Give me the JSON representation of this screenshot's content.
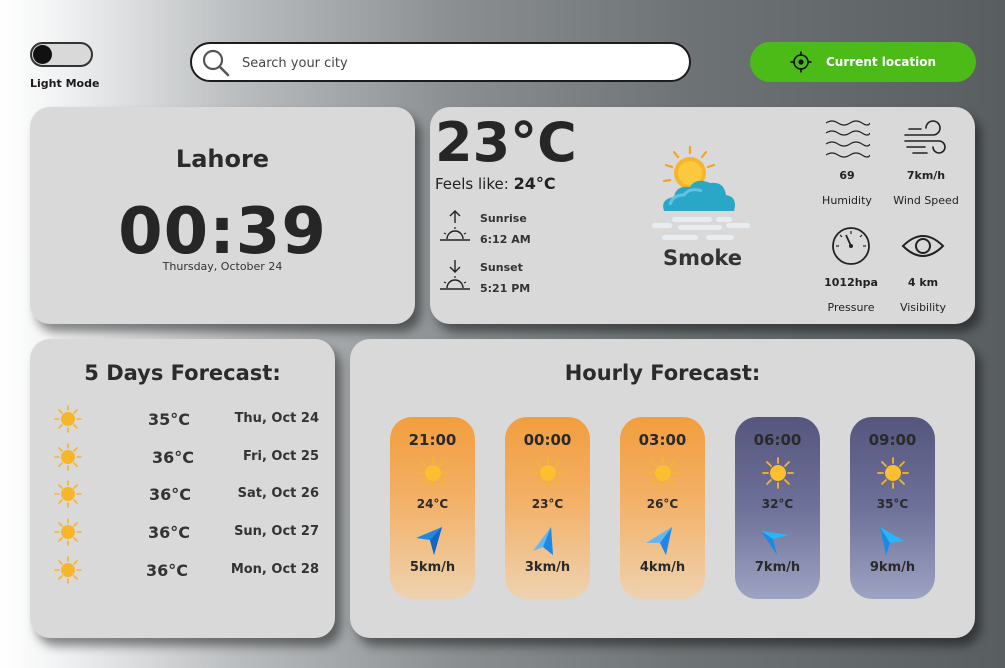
{
  "header": {
    "mode_label": "Light Mode",
    "search_placeholder": "Search your city",
    "location_button": "Current location"
  },
  "city": {
    "name": "Lahore",
    "time": "00:39",
    "date": "Thursday, October 24"
  },
  "current": {
    "temperature": "23°C",
    "feels_like_label": "Feels like:",
    "feels_like_value": "24°C",
    "sunrise_label": "Sunrise",
    "sunrise_time": "6:12 AM",
    "sunset_label": "Sunset",
    "sunset_time": "5:21 PM",
    "condition": "Smoke",
    "stats": [
      {
        "icon": "humidity-waves-icon",
        "value": "69",
        "label": "Humidity"
      },
      {
        "icon": "wind-icon",
        "value": "7km/h",
        "label": "Wind Speed"
      },
      {
        "icon": "pressure-gauge-icon",
        "value": "1012hpa",
        "label": "Pressure"
      },
      {
        "icon": "eye-icon",
        "value": "4 km",
        "label": "Visibility"
      }
    ]
  },
  "five_day": {
    "title": "5 Days Forecast:",
    "days": [
      {
        "temp": "35°C",
        "date": "Thu, Oct 24"
      },
      {
        "temp": "36°C",
        "date": "Fri, Oct 25"
      },
      {
        "temp": "36°C",
        "date": "Sat, Oct 26"
      },
      {
        "temp": "36°C",
        "date": "Sun, Oct 27"
      },
      {
        "temp": "36°C",
        "date": "Mon, Oct 28"
      }
    ]
  },
  "hourly": {
    "title": "Hourly Forecast:",
    "hours": [
      {
        "time": "21:00",
        "temp": "24°C",
        "wind": "5km/h",
        "theme": "day"
      },
      {
        "time": "00:00",
        "temp": "23°C",
        "wind": "3km/h",
        "theme": "day"
      },
      {
        "time": "03:00",
        "temp": "26°C",
        "wind": "4km/h",
        "theme": "day"
      },
      {
        "time": "06:00",
        "temp": "32°C",
        "wind": "7km/h",
        "theme": "night"
      },
      {
        "time": "09:00",
        "temp": "35°C",
        "wind": "9km/h",
        "theme": "night"
      }
    ]
  },
  "colors": {
    "accent_green": "#4cbb17",
    "card_bg": "#d9d9d9",
    "sun_yellow": "#f7b52c",
    "arrow_blue": "#1e88e5"
  }
}
